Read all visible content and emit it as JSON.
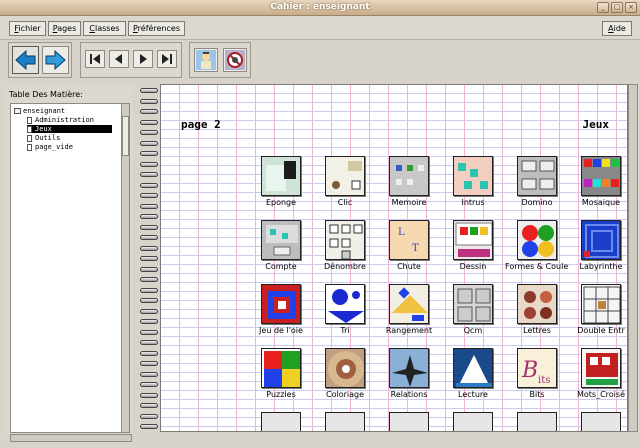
{
  "window": {
    "title": "Cahier :    enseignant",
    "controls": [
      "_",
      "□",
      "×"
    ]
  },
  "menu": {
    "items": [
      "Fichier",
      "Pages",
      "Classes",
      "Préférences"
    ],
    "help": "Aide"
  },
  "sidebar": {
    "toc_label": "Table Des Matière:",
    "tree": [
      {
        "label": "enseignant",
        "level": 0,
        "selected": false
      },
      {
        "label": "Administration",
        "level": 1,
        "selected": false
      },
      {
        "label": "Jeux",
        "level": 1,
        "selected": true
      },
      {
        "label": "Outils",
        "level": 1,
        "selected": false
      },
      {
        "label": "page_vide",
        "level": 1,
        "selected": false
      }
    ]
  },
  "page": {
    "number": "page 2",
    "section": "Jeux"
  },
  "games": [
    "Eponge",
    "Clic",
    "Memoire",
    "Intrus",
    "Domino",
    "Mosaique",
    "Compte",
    "Dénombre",
    "Chute",
    "Dessin",
    "Formes & Couleur",
    "Labyrinthe",
    "Jeu de l'oie",
    "Tri",
    "Rangement",
    "Qcm",
    "Lettres",
    "Double Entr",
    "Puzzles",
    "Coloriage",
    "Relations",
    "Lecture",
    "Bits",
    "Mots_Croisé"
  ],
  "colors": {
    "accent": "#1a7fc4",
    "title_bar": "#c8ac8a",
    "selection": "#000000"
  }
}
